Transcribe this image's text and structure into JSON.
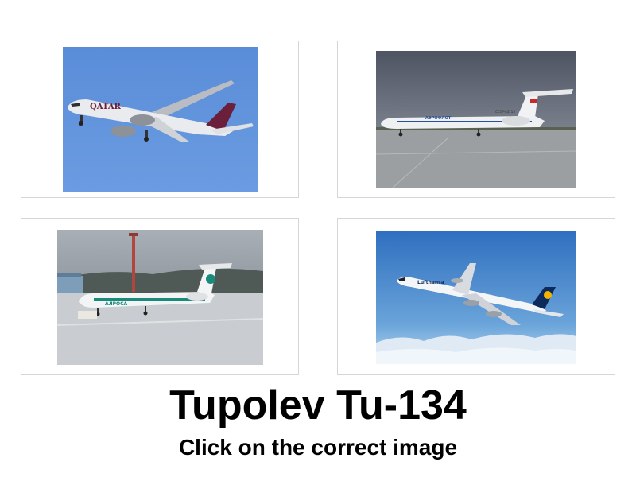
{
  "quiz": {
    "title": "Tupolev Tu-134",
    "instruction": "Click on the correct image"
  },
  "options": [
    {
      "icon": "qatar-airways-boeing-787-in-flight-image",
      "livery_text": "QATAR",
      "sky_color": "#5c8fd8"
    },
    {
      "icon": "aeroflot-tu-154-on-apron-image",
      "livery_text": "АЭРОФЛОТ",
      "registration": "CCCP-85115",
      "sky_color": "#5e6472"
    },
    {
      "icon": "tupolev-tu-134-on-snowy-apron-image",
      "livery_text": "АЛРОСА",
      "sky_color": "#9aa1a8"
    },
    {
      "icon": "lufthansa-airbus-a340-over-clouds-image",
      "livery_text": "Lufthansa",
      "sky_color": "#3d79c2"
    }
  ]
}
